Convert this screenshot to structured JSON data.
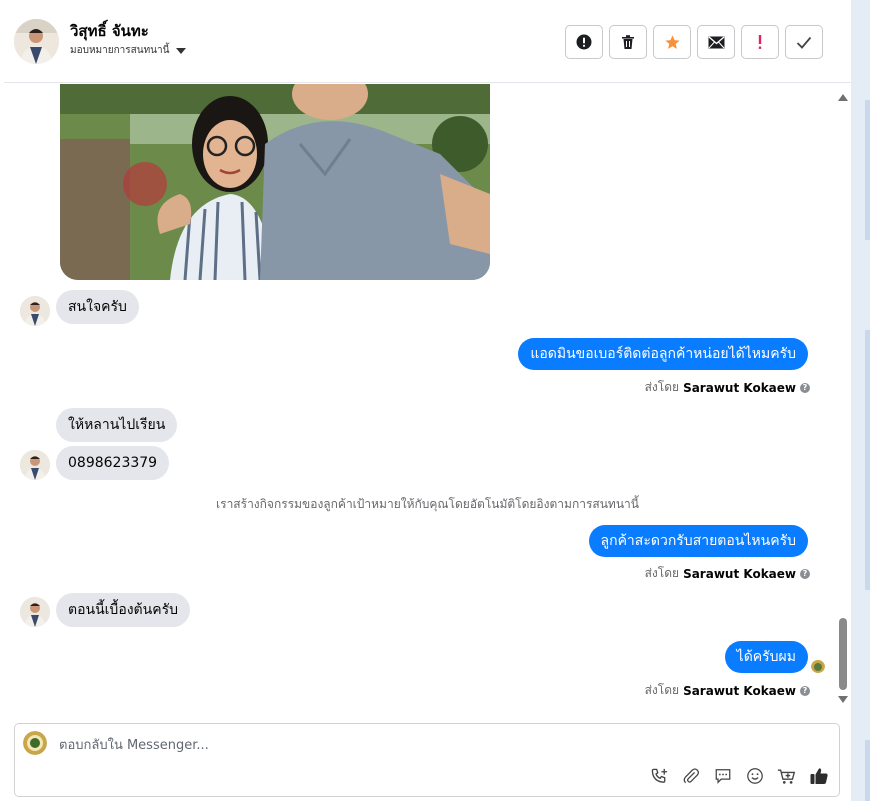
{
  "header": {
    "contact_name": "วิสุทธิ์ จันทะ",
    "assign_label": "มอบหมายการสนทนานี้",
    "actions": [
      {
        "name": "spam-icon"
      },
      {
        "name": "trash-icon"
      },
      {
        "name": "star-icon",
        "color": "#f7923a"
      },
      {
        "name": "envelope-icon"
      },
      {
        "name": "exclamation-icon",
        "color": "#e0245e"
      },
      {
        "name": "checkmark-icon"
      }
    ]
  },
  "messages": {
    "m1": "สนใจครับ",
    "m2": "แอดมินขอเบอร์ติดต่อลูกค้าหน่อยได้ไหมครับ",
    "m3": "ให้หลานไปเรียน",
    "m4": "0898623379",
    "sys": "เราสร้างกิจกรรมของลูกค้าเป้าหมายให้กับคุณโดยอัตโนมัติโดยอิงตามการสนทนานี้",
    "m5": "ลูกค้าสะดวกรับสายตอนไหนครับ",
    "m6": "ตอนนี้เบื้องต้นครับ",
    "m7": "ได้ครับผม"
  },
  "sent_by": {
    "prefix": "ส่งโดย",
    "agent": "Sarawut Kokaew"
  },
  "composer": {
    "placeholder": "ตอบกลับใน Messenger..."
  },
  "colors": {
    "outgoing_bubble": "#0a7cff",
    "incoming_bubble": "#e4e6eb"
  }
}
